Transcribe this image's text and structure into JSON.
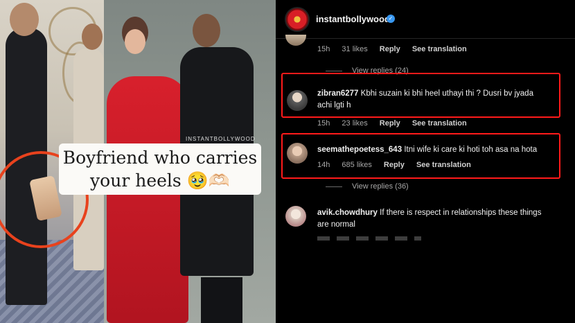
{
  "media": {
    "caption_line1": "Boyfriend who carries",
    "caption_line2": "your heels 🥹🫶🏻",
    "watermark": "INSTANTBOLLYWOOD"
  },
  "header": {
    "username": "instantbollywood",
    "verified": "✓"
  },
  "comments": [
    {
      "id": "c0",
      "meta": {
        "time": "15h",
        "likes": "31 likes",
        "reply": "Reply",
        "translate": "See translation"
      },
      "view_replies": "View replies (24)"
    },
    {
      "id": "c1",
      "username": "zibran6277",
      "text_line1": "Kbhi suzain ki bhi heel uthayi thi ? Dusri bv jyada",
      "text_line2": "achi lgti h",
      "meta": {
        "time": "15h",
        "likes": "23 likes",
        "reply": "Reply",
        "translate": "See translation"
      },
      "highlighted": true
    },
    {
      "id": "c2",
      "username": "seemathepoetess_643",
      "text_line1": "Itni wife ki care ki hoti toh asa na hota",
      "meta": {
        "time": "14h",
        "likes": "685 likes",
        "reply": "Reply",
        "translate": "See translation"
      },
      "view_replies": "View replies (36)",
      "highlighted": true
    },
    {
      "id": "c3",
      "username": "avik.chowdhury",
      "text_line1": "If there is respect in relationships these things",
      "text_line2": "are normal"
    }
  ],
  "colors": {
    "highlight": "#ff1a1a",
    "annotation_circle": "#e8421d",
    "verified": "#3897f0"
  }
}
